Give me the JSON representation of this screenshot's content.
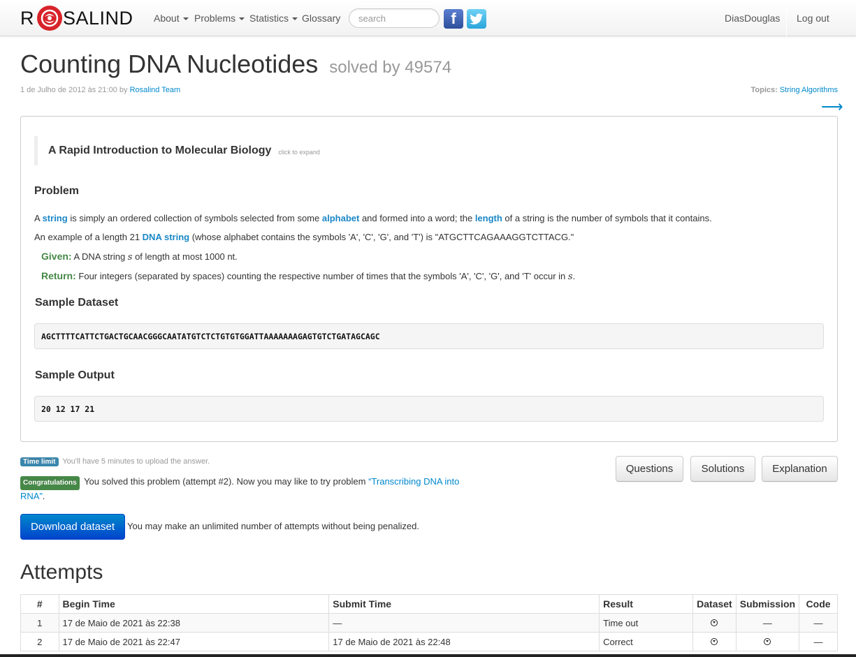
{
  "nav": {
    "brand_r": "R",
    "brand_rest": "SALIND",
    "items": [
      {
        "label": "About",
        "dropdown": true
      },
      {
        "label": "Problems",
        "dropdown": true
      },
      {
        "label": "Statistics",
        "dropdown": true
      },
      {
        "label": "Glossary",
        "dropdown": false
      }
    ],
    "search_placeholder": "search",
    "facebook_icon": "facebook-icon",
    "twitter_icon": "twitter-icon",
    "username": "DiasDouglas",
    "logout": "Log out"
  },
  "problem": {
    "title": "Counting DNA Nucleotides",
    "solved_by": "solved by 49574",
    "date": "1 de Julho de 2012 às 21:00 by",
    "author": "Rosalind Team",
    "topics_label": "Topics:",
    "topic": "String Algorithms",
    "next_arrow": "⟶",
    "intro_title": "A Rapid Introduction to Molecular Biology",
    "expand": "click to expand",
    "problem_heading": "Problem",
    "p1": {
      "t1": "A ",
      "l1": "string",
      "t2": " is simply an ordered collection of symbols selected from some ",
      "l2": "alphabet",
      "t3": " and formed into a word; the ",
      "l3": "length",
      "t4": " of a string is the number of symbols that it contains."
    },
    "p2": {
      "t1": "An example of a length 21 ",
      "l1": "DNA string",
      "t2": " (whose alphabet contains the symbols 'A', 'C', 'G', and 'T') is \"ATGCTTCAGAAAGGTCTTACG.\""
    },
    "given": {
      "label": "Given:",
      "t1": " A DNA string ",
      "var": "s",
      "t2": " of length at most 1000 nt."
    },
    "return": {
      "label": "Return:",
      "t1": " Four integers (separated by spaces) counting the respective number of times that the symbols 'A', 'C', 'G', and 'T' occur in ",
      "var": "s",
      "t2": "."
    },
    "sample_dataset_heading": "Sample Dataset",
    "sample_dataset": "AGCTTTTCATTCTGACTGCAACGGGCAATATGTCTCTGTGTGGATTAAAAAAAGAGTGTCTGATAGCAGC",
    "sample_output_heading": "Sample Output",
    "sample_output": "20 12 17 21"
  },
  "status": {
    "time_badge": "Time limit",
    "time_text": "You'll have 5 minutes to upload the answer.",
    "congrats_badge": "Congratulations",
    "congrats_text": "You solved this problem (attempt #2). Now you may like to try problem ",
    "next_problem": "“Transcribing DNA into RNA”",
    "congrats_end": ".",
    "buttons": {
      "questions": "Questions",
      "solutions": "Solutions",
      "explanation": "Explanation"
    },
    "download": "Download dataset",
    "unlimited": "You may make an unlimited number of attempts without being penalized."
  },
  "attempts": {
    "heading": "Attempts",
    "columns": [
      "#",
      "Begin Time",
      "Submit Time",
      "Result",
      "Dataset",
      "Submission",
      "Code"
    ],
    "rows": [
      {
        "num": "1",
        "begin": "17 de Maio de 2021 às 22:38",
        "submit": "—",
        "result": "Time out",
        "dataset": "download-icon",
        "submission": "—",
        "code": "—"
      },
      {
        "num": "2",
        "begin": "17 de Maio de 2021 às 22:47",
        "submit": "17 de Maio de 2021 às 22:48",
        "result": "Correct",
        "dataset": "download-icon",
        "submission": "download-icon",
        "code": "—"
      }
    ]
  }
}
